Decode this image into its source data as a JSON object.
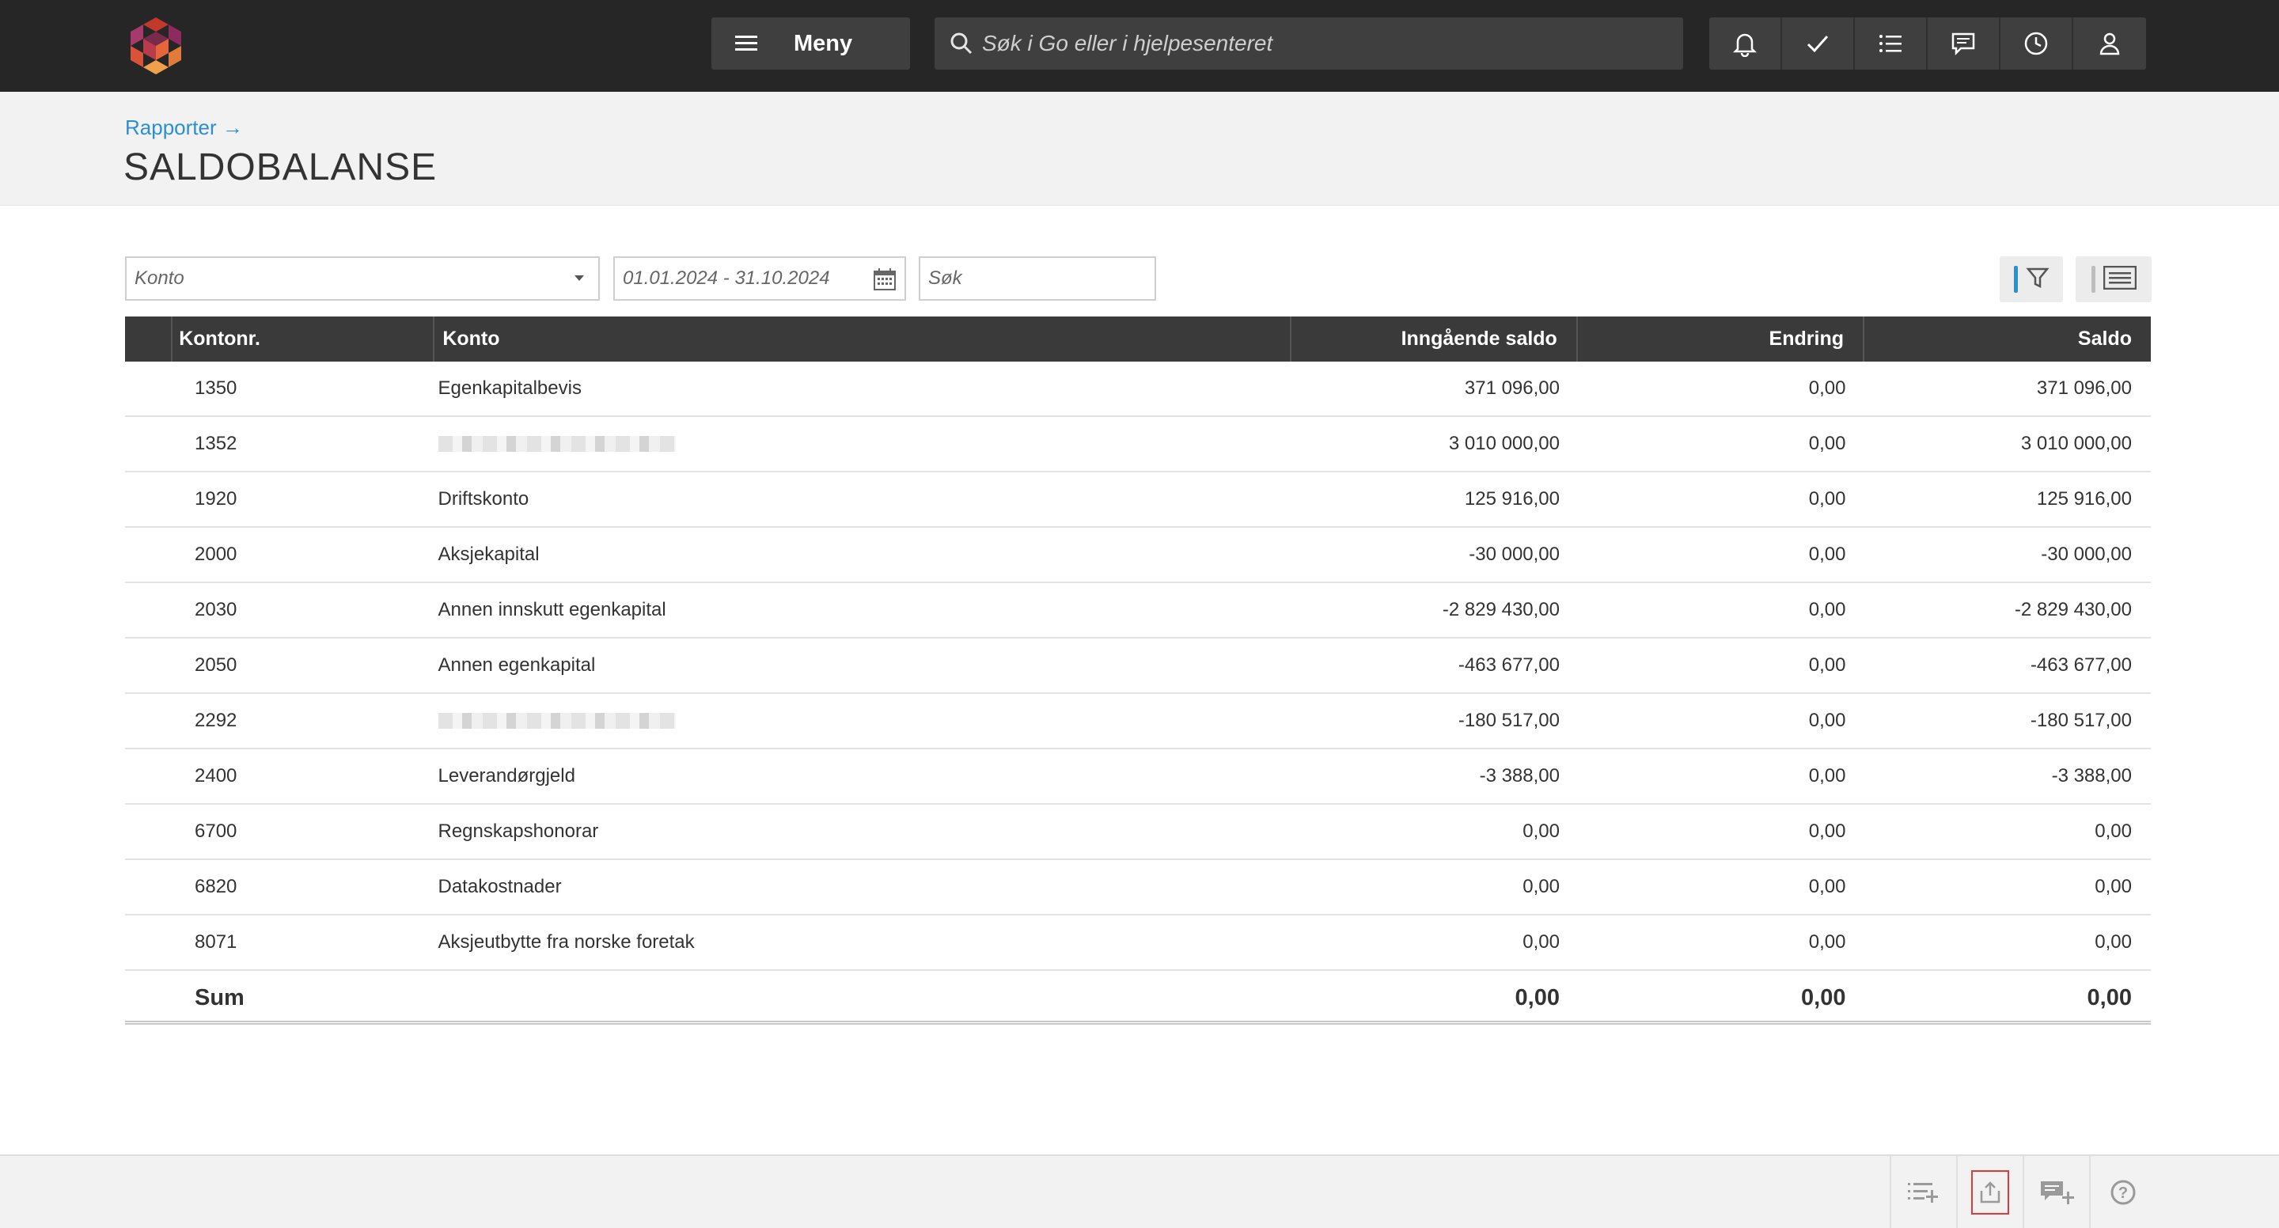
{
  "topbar": {
    "menu_label": "Meny",
    "search_placeholder": "Søk i Go eller i hjelpesenteret",
    "icons": [
      "bell-icon",
      "check-icon",
      "list-icon",
      "chat-icon",
      "clock-icon",
      "user-icon"
    ]
  },
  "header": {
    "breadcrumb": "Rapporter →",
    "title": "SALDOBALANSE"
  },
  "filters": {
    "konto_placeholder": "Konto",
    "date_range": "01.01.2024 - 31.10.2024",
    "search_placeholder": "Søk"
  },
  "table": {
    "columns": [
      "Kontonr.",
      "Konto",
      "Inngående saldo",
      "Endring",
      "Saldo"
    ],
    "rows": [
      {
        "nr": "1350",
        "konto": "Egenkapitalbevis",
        "inngaende": "371 096,00",
        "endring": "0,00",
        "saldo": "371 096,00",
        "blurred": false
      },
      {
        "nr": "1352",
        "konto": "",
        "inngaende": "3 010 000,00",
        "endring": "0,00",
        "saldo": "3 010 000,00",
        "blurred": true
      },
      {
        "nr": "1920",
        "konto": "Driftskonto",
        "inngaende": "125 916,00",
        "endring": "0,00",
        "saldo": "125 916,00",
        "blurred": false
      },
      {
        "nr": "2000",
        "konto": "Aksjekapital",
        "inngaende": "-30 000,00",
        "endring": "0,00",
        "saldo": "-30 000,00",
        "blurred": false
      },
      {
        "nr": "2030",
        "konto": "Annen innskutt egenkapital",
        "inngaende": "-2 829 430,00",
        "endring": "0,00",
        "saldo": "-2 829 430,00",
        "blurred": false
      },
      {
        "nr": "2050",
        "konto": "Annen egenkapital",
        "inngaende": "-463 677,00",
        "endring": "0,00",
        "saldo": "-463 677,00",
        "blurred": false
      },
      {
        "nr": "2292",
        "konto": "",
        "inngaende": "-180 517,00",
        "endring": "0,00",
        "saldo": "-180 517,00",
        "blurred": true
      },
      {
        "nr": "2400",
        "konto": "Leverandørgjeld",
        "inngaende": "-3 388,00",
        "endring": "0,00",
        "saldo": "-3 388,00",
        "blurred": false
      },
      {
        "nr": "6700",
        "konto": "Regnskapshonorar",
        "inngaende": "0,00",
        "endring": "0,00",
        "saldo": "0,00",
        "blurred": false
      },
      {
        "nr": "6820",
        "konto": "Datakostnader",
        "inngaende": "0,00",
        "endring": "0,00",
        "saldo": "0,00",
        "blurred": false
      },
      {
        "nr": "8071",
        "konto": "Aksjeutbytte fra norske foretak",
        "inngaende": "0,00",
        "endring": "0,00",
        "saldo": "0,00",
        "blurred": false
      }
    ],
    "sum": {
      "label": "Sum",
      "inngaende": "0,00",
      "endring": "0,00",
      "saldo": "0,00"
    }
  },
  "footer": {
    "icons": [
      "add-list-icon",
      "export-icon",
      "add-comment-icon",
      "help-icon"
    ],
    "active": "export-icon"
  },
  "colors": {
    "topbar": "#262626",
    "link": "#2c8fd0",
    "table_header": "#3a3a3a",
    "active_outline": "#e03a3a"
  }
}
